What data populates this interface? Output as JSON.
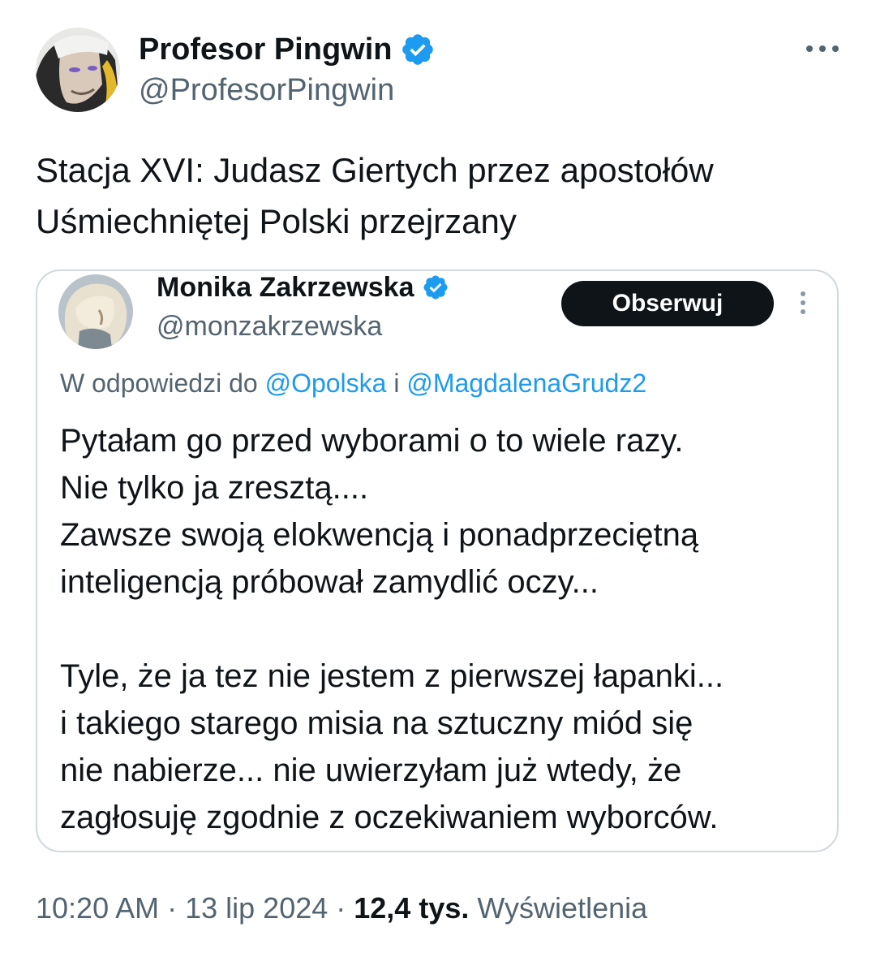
{
  "tweet": {
    "author_name": "Profesor Pingwin",
    "author_handle": "@ProfesorPingwin",
    "verified_icon": "verified-badge-icon",
    "text_lines": [
      "Stacja XVI: Judasz Giertych przez apostołów",
      "Uśmiechniętej Polski przejrzany"
    ]
  },
  "quoted_tweet": {
    "author_name": "Monika Zakrzewska",
    "author_handle": "@monzakrzewska",
    "follow_label": "Obserwuj",
    "reply_prefix": "W odpowiedzi do ",
    "reply_mention_1": "@Opolska",
    "reply_joiner": " i ",
    "reply_mention_2": "@MagdalenaGrudz2",
    "paragraph_1": [
      "Pytałam go przed wyborami o to wiele razy.",
      "Nie tylko ja zresztą....",
      "Zawsze swoją elokwencją i ponadprzeciętną",
      "inteligencją próbował zamydlić oczy..."
    ],
    "paragraph_2": [
      "Tyle, że ja tez nie jestem z pierwszej łapanki...",
      "i takiego starego misia na sztuczny miód się",
      "nie nabierze... nie uwierzyłam już wtedy, że",
      "zagłosuję zgodnie z oczekiwaniem wyborców."
    ]
  },
  "meta": {
    "time": "10:20 AM",
    "separator": " · ",
    "date": "13 lip 2024",
    "views_count": "12,4 tys.",
    "views_label": "Wyświetlenia"
  },
  "colors": {
    "text_primary": "#0f1419",
    "text_secondary": "#536471",
    "accent": "#1d9bf0",
    "border": "#cfd9de",
    "button_bg": "#0f1419"
  }
}
